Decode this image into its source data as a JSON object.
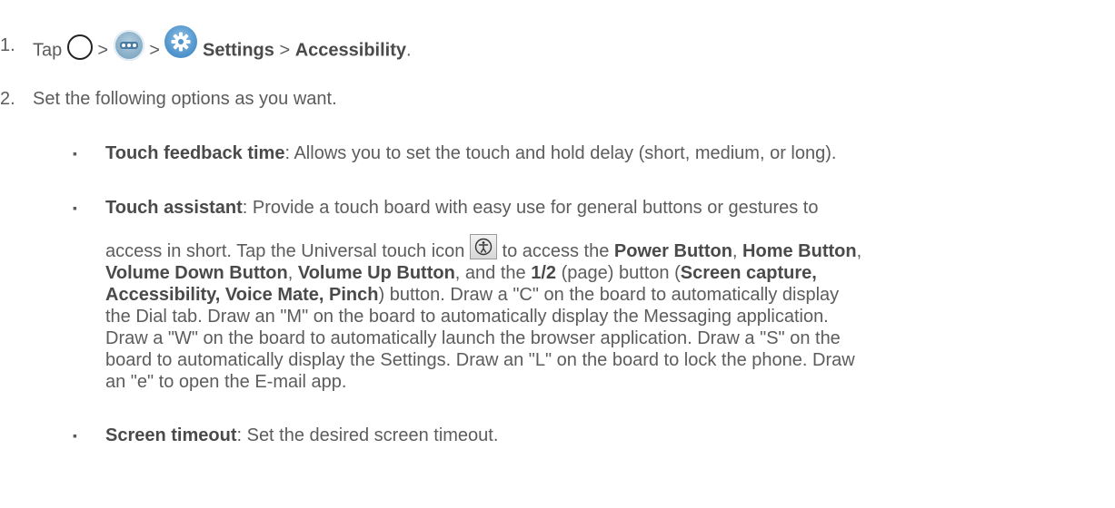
{
  "steps": [
    {
      "number": "1.",
      "parts": {
        "tap": "Tap",
        "sep1": ">",
        "sep2": ">",
        "settings": "Settings",
        "sep3": ">",
        "accessibility": "Accessibility",
        "end": "."
      },
      "icons": [
        "home-circle-icon",
        "apps-icon",
        "settings-gear-icon"
      ]
    },
    {
      "number": "2.",
      "text": "Set the following options as you want."
    }
  ],
  "options": [
    {
      "title": "Touch feedback time",
      "description": ": Allows you to set the touch and hold delay (short, medium, or long)."
    },
    {
      "title": "Touch assistant",
      "line1": ": Provide a touch board with easy use for general buttons or gestures to",
      "line2_pre": "access in short. Tap the Universal touch icon",
      "line2_post": "to access the",
      "power_button": "Power Button",
      "comma1": ",",
      "home_button": "Home Button",
      "comma2": ",",
      "volume_down": "Volume Down Button",
      "comma3": ",",
      "volume_up": "Volume Up Button",
      "and_the": ", and the",
      "page_label": "1/2",
      "page_paren": "(page) button (",
      "screen_capture": "Screen capture,",
      "line4_bold": "Accessibility, Voice Mate, Pinch",
      "line4_rest": ") button. Draw a \"C\" on the board to automatically display",
      "line5": "the Dial tab. Draw an \"M\" on the board to automatically display the Messaging application.",
      "line6": "Draw a \"W\" on the board to automatically launch the browser application. Draw a \"S\" on the",
      "line7": "board to automatically display the Settings. Draw an \"L\" on the board to lock the phone. Draw",
      "line8": "an \"e\" to open the E-mail app.",
      "icon": "universal-touch-icon"
    },
    {
      "title": "Screen timeout",
      "description": ": Set the desired screen timeout."
    }
  ],
  "bullet_glyph": "▪"
}
